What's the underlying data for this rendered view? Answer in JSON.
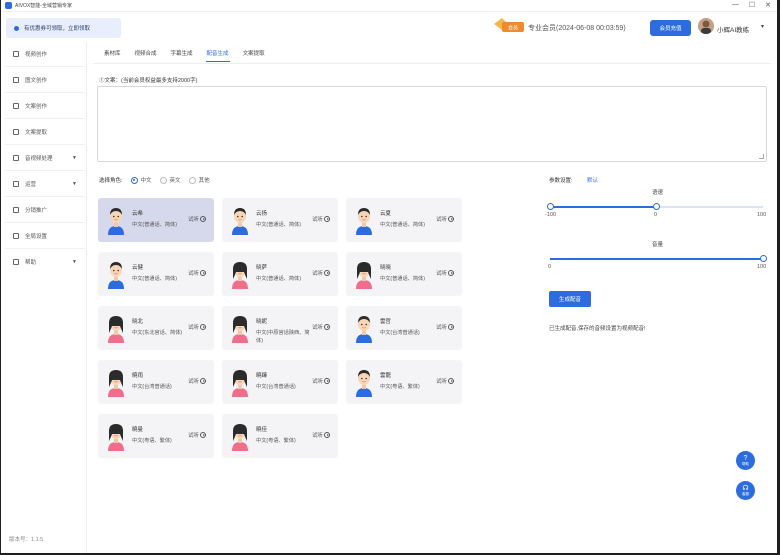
{
  "window": {
    "title": "AIVOX智能-全域营销专家",
    "controls": [
      "—",
      "☐",
      "✕"
    ]
  },
  "header": {
    "notice": "有优惠券可领取，立即领取",
    "vip_badge": "会员",
    "vip_text": "专业会员(2024-06-08 00:03:59)",
    "renew_label": "会员充值",
    "username": "小辉AI教练"
  },
  "sidebar": {
    "items": [
      {
        "label": "视频创作",
        "icon": "video-icon"
      },
      {
        "label": "图文创作",
        "icon": "image-icon"
      },
      {
        "label": "文案创作",
        "icon": "doc-icon"
      },
      {
        "label": "文案提取",
        "icon": "extract-icon"
      },
      {
        "label": "音视频处理",
        "icon": "media-icon",
        "expand": true
      },
      {
        "label": "运营",
        "icon": "ops-icon",
        "expand": true
      },
      {
        "label": "分销推广",
        "icon": "share-icon"
      },
      {
        "label": "全局设置",
        "icon": "gear-icon"
      },
      {
        "label": "帮助",
        "icon": "help-icon",
        "expand": true
      }
    ],
    "version": "版本号：1.1.5"
  },
  "tabs": [
    {
      "label": "素材库",
      "active": false
    },
    {
      "label": "视频合成",
      "active": false
    },
    {
      "label": "字幕生成",
      "active": false
    },
    {
      "label": "配音生成",
      "active": true
    },
    {
      "label": "文案提取",
      "active": false
    }
  ],
  "text_section": {
    "label": "①文案：(当前会员权益最多支持2000字)",
    "value": ""
  },
  "role_select": {
    "label": "选择角色:",
    "options": [
      {
        "label": "中文",
        "checked": true
      },
      {
        "label": "英文",
        "checked": false
      },
      {
        "label": "其他",
        "checked": false
      }
    ]
  },
  "voices": [
    {
      "name": "云希",
      "desc": "中文(普通话、简体)",
      "try": "试听",
      "gender": "male",
      "selected": true
    },
    {
      "name": "云扬",
      "desc": "中文(普通话、简体)",
      "try": "试听",
      "gender": "male",
      "selected": false
    },
    {
      "name": "云夏",
      "desc": "中文(普通话、简体)",
      "try": "试听",
      "gender": "male",
      "selected": false
    },
    {
      "name": "云健",
      "desc": "中文(普通话、简体)",
      "try": "试听",
      "gender": "male",
      "selected": false
    },
    {
      "name": "晓萨",
      "desc": "中文(普通话、简体)",
      "try": "试听",
      "gender": "female",
      "selected": false
    },
    {
      "name": "晓晓",
      "desc": "中文(普通话、简体)",
      "try": "试听",
      "gender": "female",
      "selected": false
    },
    {
      "name": "晓北",
      "desc": "中文(东北官话、简体)",
      "try": "试听",
      "gender": "female",
      "selected": false
    },
    {
      "name": "晓妮",
      "desc": "中文(中原官话陕西、简体)",
      "try": "试听",
      "gender": "female",
      "selected": false
    },
    {
      "name": "雲哲",
      "desc": "中文(台湾普通话)",
      "try": "试听",
      "gender": "male",
      "selected": false
    },
    {
      "name": "曉雨",
      "desc": "中文(台湾普通话)",
      "try": "试听",
      "gender": "female",
      "selected": false
    },
    {
      "name": "曉臻",
      "desc": "中文(台湾普通话)",
      "try": "试听",
      "gender": "female",
      "selected": false
    },
    {
      "name": "雲龍",
      "desc": "中文(粤语、繁体)",
      "try": "试听",
      "gender": "male",
      "selected": false
    },
    {
      "name": "曉曼",
      "desc": "中文(粤语、繁体)",
      "try": "试听",
      "gender": "female",
      "selected": false
    },
    {
      "name": "曉佳",
      "desc": "中文(粤语、繁体)",
      "try": "试听",
      "gender": "female",
      "selected": false
    }
  ],
  "params": {
    "label": "参数设置:",
    "default_link": "默认",
    "speed": {
      "title": "语速",
      "min": "-100",
      "mid": "0",
      "max": "100",
      "value": 0
    },
    "volume": {
      "title": "音量",
      "min": "0",
      "max": "100",
      "value": 100
    },
    "generate_label": "生成配音",
    "note": "已生成配音,保存的音频设置为视频配音!"
  },
  "float": {
    "help_label": "帮助",
    "service_label": "客服"
  },
  "colors": {
    "accent": "#2d6cdf",
    "selected_card": "#d6d8ec",
    "card": "#f4f4f6"
  }
}
